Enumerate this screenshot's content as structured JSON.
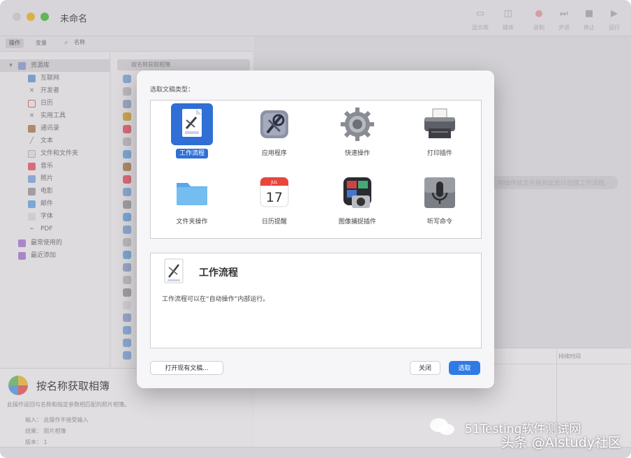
{
  "window": {
    "title": "未命名",
    "toolbar": [
      {
        "label": "显示库",
        "icon": "library-icon"
      },
      {
        "label": "媒体",
        "icon": "media-icon"
      },
      {
        "label": "录制",
        "icon": "record-icon"
      },
      {
        "label": "步进",
        "icon": "step-icon"
      },
      {
        "label": "停止",
        "icon": "stop-icon"
      },
      {
        "label": "运行",
        "icon": "run-icon"
      }
    ]
  },
  "library": {
    "tabs": [
      "操作",
      "变量"
    ],
    "search_placeholder": "名称",
    "root": "资源库",
    "items": [
      "互联网",
      "开发者",
      "日历",
      "实用工具",
      "通讯录",
      "文本",
      "文件和文件夹",
      "音乐",
      "照片",
      "电影",
      "邮件",
      "字体",
      "PDF"
    ],
    "extra": [
      "最常使用的",
      "最近添加"
    ]
  },
  "actions": {
    "first": "按名称获取相簿"
  },
  "description": {
    "title": "按名称获取相簿",
    "text": "此操作返回与名称和指定参数相匹配的照片相簿。",
    "rows": [
      {
        "key": "输入：",
        "value": "此操作不接受输入"
      },
      {
        "key": "结果：",
        "value": "照片相簿"
      },
      {
        "key": "版本：",
        "value": "1"
      }
    ]
  },
  "workflow": {
    "hint": "将操作或文件拖到此处以创建工作流程。",
    "log_header": "持续时间"
  },
  "dialog": {
    "prompt": "选取文稿类型：",
    "types": [
      {
        "label": "工作流程",
        "icon": "workflow-doc-icon",
        "selected": true
      },
      {
        "label": "应用程序",
        "icon": "application-icon",
        "selected": false
      },
      {
        "label": "快速操作",
        "icon": "quick-action-gear-icon",
        "selected": false
      },
      {
        "label": "打印插件",
        "icon": "printer-icon",
        "selected": false
      },
      {
        "label": "文件夹操作",
        "icon": "folder-icon",
        "selected": false
      },
      {
        "label": "日历提醒",
        "icon": "calendar-icon",
        "selected": false
      },
      {
        "label": "图像捕捉插件",
        "icon": "image-capture-icon",
        "selected": false
      },
      {
        "label": "听写命令",
        "icon": "microphone-icon",
        "selected": false
      }
    ],
    "calendar_day": "17",
    "calendar_month": "JUL",
    "info_title": "工作流程",
    "info_desc": "工作流程可以在“自动操作”内部运行。",
    "open_existing": "打开现有文稿...",
    "close": "关闭",
    "choose": "选取"
  },
  "watermark": {
    "line1": "51Testing软件测试网",
    "line2": "头条 @AIstudy社区"
  }
}
